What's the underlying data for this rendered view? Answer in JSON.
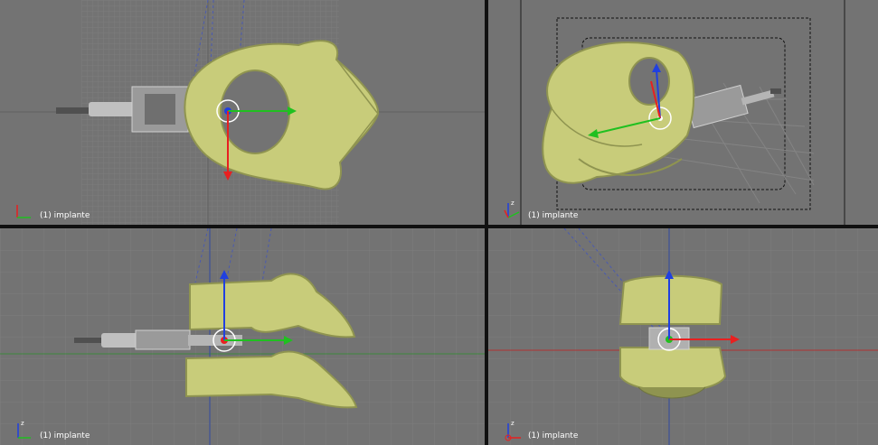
{
  "viewports": {
    "top_left": {
      "label": "(1) implante",
      "view": "top"
    },
    "top_right": {
      "label": "(1) implante",
      "view": "camera"
    },
    "bottom_left": {
      "label": "(1) implante",
      "view": "side"
    },
    "bottom_right": {
      "label": "(1) implante",
      "view": "front"
    }
  },
  "axis_letters": {
    "x": "x",
    "y": "y",
    "z": "z"
  },
  "colors": {
    "viewport_bg": "#737373",
    "grid": "#808080",
    "bone": "#c8cc7a",
    "bone_shadow": "#8f9450",
    "implant": "#b0b0b0",
    "axis_x": "#e82020",
    "axis_y": "#20c020",
    "axis_z": "#2040e0",
    "selection": "#ffffff"
  },
  "icons": {
    "manipulator": "transform-widget-icon",
    "axis": "axis-gizmo-icon"
  }
}
